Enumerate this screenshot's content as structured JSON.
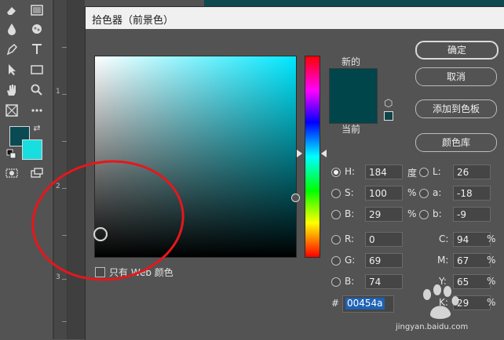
{
  "dialog": {
    "title": "拾色器（前景色）",
    "new_label": "新的",
    "current_label": "当前",
    "web_only_label": "只有 Web 颜色",
    "buttons": {
      "ok": "确定",
      "cancel": "取消",
      "add_swatch": "添加到色板",
      "color_library": "颜色库"
    },
    "hsb": {
      "h": {
        "label": "H:",
        "value": "184",
        "unit": "度"
      },
      "s": {
        "label": "S:",
        "value": "100",
        "unit": "%"
      },
      "b": {
        "label": "B:",
        "value": "29",
        "unit": "%"
      }
    },
    "lab": {
      "l": {
        "label": "L:",
        "value": "26"
      },
      "a": {
        "label": "a:",
        "value": "-18"
      },
      "b": {
        "label": "b:",
        "value": "-9"
      }
    },
    "rgb": {
      "r": {
        "label": "R:",
        "value": "0"
      },
      "g": {
        "label": "G:",
        "value": "69"
      },
      "b": {
        "label": "B:",
        "value": "74"
      }
    },
    "cmyk": {
      "c": {
        "label": "C:",
        "value": "94",
        "unit": "%"
      },
      "m": {
        "label": "M:",
        "value": "67",
        "unit": "%"
      },
      "y": {
        "label": "Y:",
        "value": "65",
        "unit": "%"
      },
      "k": {
        "label": "K:",
        "value": "29",
        "unit": "%"
      }
    },
    "hex_label": "#",
    "hex_value": "00454a",
    "colors": {
      "new": "#00454a",
      "current": "#00454a",
      "hue_base": "#00e7ff"
    }
  },
  "ruler": {
    "marks": [
      "1",
      "2",
      "3"
    ]
  },
  "toolbar": {
    "foreground_color": "#0a4a52",
    "background_color": "#19dedf"
  },
  "watermark": {
    "text": "jingyan.baidu.com"
  }
}
